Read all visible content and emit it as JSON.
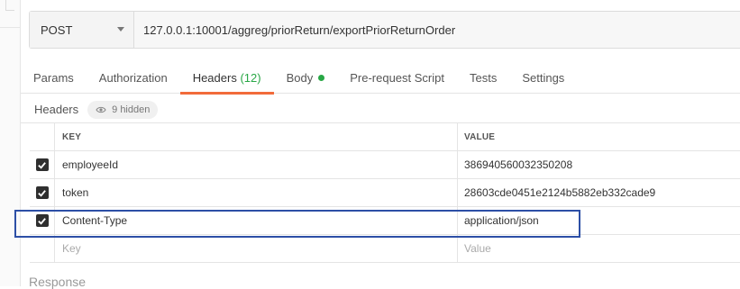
{
  "request": {
    "method": "POST",
    "url": "127.0.0.1:10001/aggreg/priorReturn/exportPriorReturnOrder"
  },
  "tabs": {
    "params": "Params",
    "authorization": "Authorization",
    "headers": "Headers",
    "headers_count": "(12)",
    "body": "Body",
    "prerequest": "Pre-request Script",
    "tests": "Tests",
    "settings": "Settings"
  },
  "headers_bar": {
    "title": "Headers",
    "hidden": "9 hidden"
  },
  "table": {
    "key_header": "KEY",
    "value_header": "VALUE",
    "rows": [
      {
        "key": "employeeId",
        "value": "386940560032350208",
        "checked": true
      },
      {
        "key": "token",
        "value": "28603cde0451e2124b5882eb332cade9",
        "checked": true
      },
      {
        "key": "Content-Type",
        "value": "application/json",
        "checked": true
      }
    ],
    "key_placeholder": "Key",
    "value_placeholder": "Value"
  },
  "response": {
    "label": "Response"
  },
  "colors": {
    "accent": "#f26b3a",
    "count_green": "#28a745",
    "highlight_border": "#2d4fa6"
  }
}
